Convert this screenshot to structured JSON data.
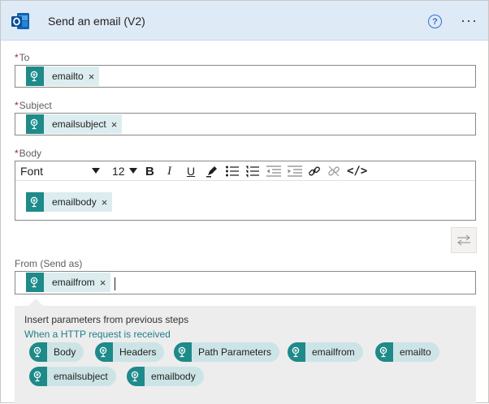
{
  "header": {
    "title": "Send an email (V2)",
    "help_glyph": "?",
    "more_glyph": "···",
    "app_icon": "outlook-icon",
    "accent": "#dfeaf7"
  },
  "fields": {
    "to": {
      "label": "To",
      "required_mark": "*",
      "token": "emailto",
      "remove": "×"
    },
    "subject": {
      "label": "Subject",
      "required_mark": "*",
      "token": "emailsubject",
      "remove": "×"
    },
    "body": {
      "label": "Body",
      "required_mark": "*",
      "token": "emailbody",
      "remove": "×"
    },
    "from": {
      "label": "From (Send as)",
      "token": "emailfrom",
      "remove": "×"
    }
  },
  "toolbar": {
    "font": "Font",
    "font_size": "12",
    "bold": "B",
    "italic": "I",
    "underline": "U",
    "code": "</>"
  },
  "dynamic_content": {
    "title": "Insert parameters from previous steps",
    "source": "When a HTTP request is received",
    "tokens": [
      "Body",
      "Headers",
      "Path Parameters",
      "emailfrom",
      "emailto",
      "emailsubject",
      "emailbody"
    ]
  },
  "colors": {
    "token_icon": "#1e8a8a",
    "token_bg": "#dcedf0",
    "link": "#1e7f8a",
    "required": "#a4262c"
  }
}
